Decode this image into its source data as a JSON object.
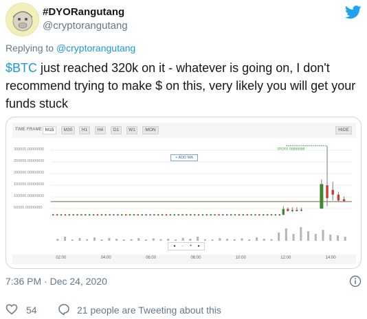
{
  "user": {
    "name": "#DYORangutang",
    "handle": "@cryptorangutang"
  },
  "replying": {
    "prefix": "Replying to",
    "to": "@cryptorangutang"
  },
  "tweet": {
    "cashtag": "$BTC",
    "text": " just reached 320k on it - whatever is going on, I don't recommend trying to make $ on this, very likely you will get your funds stuck"
  },
  "chart": {
    "timeframe_label": "TIME FRAME",
    "timeframes": [
      "M15",
      "M30",
      "H1",
      "H4",
      "D1",
      "W1",
      "MON"
    ],
    "active_timeframe": "M15",
    "hide_label": "HIDE",
    "add_ma_label": "+ ADD MA",
    "peak_label": "320201.99999998",
    "nav_buttons": [
      "◂",
      "-",
      "+",
      "▸"
    ]
  },
  "chart_data": {
    "type": "bar",
    "title": "",
    "ytick_labels": [
      "300000.00000000",
      "250000.00000000",
      "200000.00000000",
      "150000.00000000",
      "100000.00000000",
      "50000.00000000"
    ],
    "xtick_labels": [
      "02:00",
      "04:00",
      "06:00",
      "08:00",
      "10:00",
      "12:00",
      "14:00"
    ],
    "ylim": [
      0,
      330000
    ],
    "x_time_hours": [
      1.5,
      14.9
    ],
    "reference_line_price": 80000,
    "candles_flat_price": 23000,
    "candles": [
      {
        "t": 11.85,
        "open": 23000,
        "close": 48000,
        "high": 60000,
        "low": 23000
      },
      {
        "t": 12.05,
        "open": 48000,
        "close": 40000,
        "high": 55000,
        "low": 38000
      },
      {
        "t": 12.25,
        "open": 40000,
        "close": 44000,
        "high": 55000,
        "low": 35000
      },
      {
        "t": 12.45,
        "open": 44000,
        "close": 42000,
        "high": 56000,
        "low": 38000
      },
      {
        "t": 12.65,
        "open": 42000,
        "close": 45000,
        "high": 54000,
        "low": 39000
      },
      {
        "t": 13.55,
        "open": 50000,
        "close": 155000,
        "high": 175000,
        "low": 48000
      },
      {
        "t": 13.8,
        "open": 150000,
        "close": 95000,
        "high": 320202,
        "low": 60000
      },
      {
        "t": 14.05,
        "open": 130000,
        "close": 110000,
        "high": 165000,
        "low": 85000
      },
      {
        "t": 14.3,
        "open": 110000,
        "close": 85000,
        "high": 122000,
        "low": 80000
      },
      {
        "t": 14.55,
        "open": 90000,
        "close": 82000,
        "high": 102000,
        "low": 78000
      }
    ],
    "volume_relative": [
      0.15,
      0.3,
      0.1,
      0.2,
      0.12,
      0.25,
      0.1,
      0.2,
      0.15,
      0.1,
      0.12,
      0.2,
      0.1,
      0.18,
      0.12,
      0.15,
      0.1,
      0.22,
      0.15,
      0.3,
      0.12,
      0.1,
      0.2,
      0.15,
      0.12,
      0.18,
      0.1,
      0.25,
      0.15,
      0.12,
      0.6,
      0.9,
      0.5,
      1.0,
      0.7,
      0.5,
      0.8,
      0.45,
      0.4,
      0.3
    ]
  },
  "meta": {
    "time": "7:36 PM",
    "sep": " · ",
    "date": "Dec 24, 2020"
  },
  "footer": {
    "likes": "54",
    "tweeting": "21 people are Tweeting about this"
  },
  "colors": {
    "link": "#1b95e0",
    "muted": "#657786",
    "candle_up": "#3c8a2e",
    "candle_down": "#c43c3c"
  }
}
